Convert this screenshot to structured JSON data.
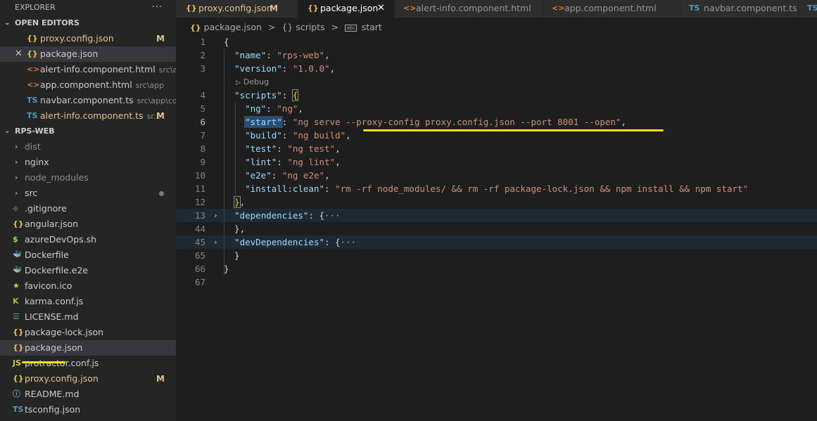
{
  "explorer": {
    "title": "EXPLORER",
    "more": "···",
    "open_editors_title": "OPEN EDITORS",
    "open_editors": [
      {
        "icon": "{}",
        "name": "proxy.config.json",
        "path": "",
        "badge": "M",
        "modified": true,
        "selected": false,
        "close": false
      },
      {
        "icon": "{}",
        "name": "package.json",
        "path": "",
        "badge": "",
        "modified": false,
        "selected": true,
        "close": true
      },
      {
        "icon": "<>",
        "name": "alert-info.component.html",
        "path": "src\\a...",
        "badge": "",
        "modified": false,
        "selected": false,
        "close": false
      },
      {
        "icon": "<>",
        "name": "app.component.html",
        "path": "src\\app",
        "badge": "",
        "modified": false,
        "selected": false,
        "close": false
      },
      {
        "icon": "TS",
        "name": "navbar.component.ts",
        "path": "src\\app\\co...",
        "badge": "",
        "modified": false,
        "selected": false,
        "close": false
      },
      {
        "icon": "TS",
        "name": "alert-info.component.ts",
        "path": "sr...",
        "badge": "M",
        "modified": true,
        "selected": false,
        "close": false
      }
    ],
    "project_title": "RPS-WEB",
    "files": [
      {
        "icon": "›",
        "name": "dist",
        "folder": true,
        "dim": true
      },
      {
        "icon": "›",
        "name": "nginx",
        "folder": true
      },
      {
        "icon": "›",
        "name": "node_modules",
        "folder": true,
        "dim": true
      },
      {
        "icon": "›",
        "name": "src",
        "folder": true,
        "dot": true
      },
      {
        "icon": "◆",
        "name": ".gitignore"
      },
      {
        "icon": "{}",
        "name": "angular.json"
      },
      {
        "icon": "$",
        "name": "azureDevOps.sh"
      },
      {
        "icon": "🐳",
        "name": "Dockerfile"
      },
      {
        "icon": "🐳",
        "name": "Dockerfile.e2e"
      },
      {
        "icon": "★",
        "name": "favicon.ico"
      },
      {
        "icon": "K",
        "name": "karma.conf.js"
      },
      {
        "icon": "☰",
        "name": "LICENSE.md"
      },
      {
        "icon": "{}",
        "name": "package-lock.json"
      },
      {
        "icon": "{}",
        "name": "package.json",
        "selected": true
      },
      {
        "icon": "JS",
        "name": "protractor.conf.js"
      },
      {
        "icon": "{}",
        "name": "proxy.config.json",
        "modified": true,
        "badge": "M"
      },
      {
        "icon": "ⓘ",
        "name": "README.md"
      },
      {
        "icon": "TS",
        "name": "tsconfig.json"
      }
    ]
  },
  "tabs": [
    {
      "icon": "{}",
      "label": "proxy.config.json",
      "badge": "M",
      "active": false
    },
    {
      "icon": "{}",
      "label": "package.json",
      "close": "✕",
      "active": true
    },
    {
      "icon": "<>",
      "label": "alert-info.component.html",
      "active": false
    },
    {
      "icon": "<>",
      "label": "app.component.html",
      "active": false
    },
    {
      "icon": "TS",
      "label": "navbar.component.ts",
      "active": false
    },
    {
      "icon": "TS",
      "label": "",
      "active": false
    }
  ],
  "breadcrumb": {
    "file_icon": "{}",
    "file": "package.json",
    "sep": ">",
    "obj_icon": "{}",
    "obj": "scripts",
    "prop_icon": "abc",
    "prop": "start"
  },
  "codelens": {
    "icon": "▷",
    "label": "Debug"
  },
  "code_lines": [
    {
      "n": "1",
      "parts": [
        [
          "p",
          "{"
        ]
      ]
    },
    {
      "n": "2",
      "parts": [
        [
          "p",
          "  "
        ],
        [
          "k",
          "\"name\""
        ],
        [
          "p",
          ": "
        ],
        [
          "s",
          "\"rps-web\""
        ],
        [
          "p",
          ","
        ]
      ]
    },
    {
      "n": "3",
      "parts": [
        [
          "p",
          "  "
        ],
        [
          "k",
          "\"version\""
        ],
        [
          "p",
          ": "
        ],
        [
          "s",
          "\"1.0.0\""
        ],
        [
          "p",
          ","
        ]
      ]
    },
    {
      "n": "4",
      "parts": [
        [
          "p",
          "  "
        ],
        [
          "k",
          "\"scripts\""
        ],
        [
          "p",
          ": "
        ],
        [
          "y",
          "{"
        ]
      ]
    },
    {
      "n": "5",
      "parts": [
        [
          "p",
          "    "
        ],
        [
          "k",
          "\"ng\""
        ],
        [
          "p",
          ": "
        ],
        [
          "s",
          "\"ng\""
        ],
        [
          "p",
          ","
        ]
      ]
    },
    {
      "n": "6",
      "parts": [
        [
          "p",
          "    "
        ],
        [
          "k",
          "\"start\""
        ],
        [
          "p",
          ": "
        ],
        [
          "s",
          "\"ng serve --proxy-config proxy.config.json --port 8001 --open\""
        ],
        [
          "p",
          ","
        ]
      ]
    },
    {
      "n": "7",
      "parts": [
        [
          "p",
          "    "
        ],
        [
          "k",
          "\"build\""
        ],
        [
          "p",
          ": "
        ],
        [
          "s",
          "\"ng build\""
        ],
        [
          "p",
          ","
        ]
      ]
    },
    {
      "n": "8",
      "parts": [
        [
          "p",
          "    "
        ],
        [
          "k",
          "\"test\""
        ],
        [
          "p",
          ": "
        ],
        [
          "s",
          "\"ng test\""
        ],
        [
          "p",
          ","
        ]
      ]
    },
    {
      "n": "9",
      "parts": [
        [
          "p",
          "    "
        ],
        [
          "k",
          "\"lint\""
        ],
        [
          "p",
          ": "
        ],
        [
          "s",
          "\"ng lint\""
        ],
        [
          "p",
          ","
        ]
      ]
    },
    {
      "n": "10",
      "parts": [
        [
          "p",
          "    "
        ],
        [
          "k",
          "\"e2e\""
        ],
        [
          "p",
          ": "
        ],
        [
          "s",
          "\"ng e2e\""
        ],
        [
          "p",
          ","
        ]
      ]
    },
    {
      "n": "11",
      "parts": [
        [
          "p",
          "    "
        ],
        [
          "k",
          "\"install:clean\""
        ],
        [
          "p",
          ": "
        ],
        [
          "s",
          "\"rm -rf node_modules/ && rm -rf package-lock.json && npm install && npm start\""
        ]
      ]
    },
    {
      "n": "12",
      "parts": [
        [
          "p",
          "  "
        ],
        [
          "y",
          "}"
        ],
        [
          "p",
          ","
        ]
      ]
    },
    {
      "n": "13",
      "parts": [
        [
          "p",
          "  "
        ],
        [
          "k",
          "\"dependencies\""
        ],
        [
          "p",
          ": {"
        ],
        [
          "e",
          "···"
        ]
      ]
    },
    {
      "n": "44",
      "parts": [
        [
          "p",
          "  },"
        ]
      ]
    },
    {
      "n": "45",
      "parts": [
        [
          "p",
          "  "
        ],
        [
          "k",
          "\"devDependencies\""
        ],
        [
          "p",
          ": {"
        ],
        [
          "e",
          "···"
        ]
      ]
    },
    {
      "n": "65",
      "parts": [
        [
          "p",
          "  }"
        ]
      ]
    },
    {
      "n": "66",
      "parts": [
        [
          "p",
          "}"
        ]
      ]
    },
    {
      "n": "67",
      "parts": []
    }
  ],
  "colors": {
    "accent_yellow": "#f5e400",
    "modified": "#e2c08d",
    "json_icon": "#e6c15a",
    "html_icon": "#e37933",
    "ts_icon": "#519aba"
  }
}
